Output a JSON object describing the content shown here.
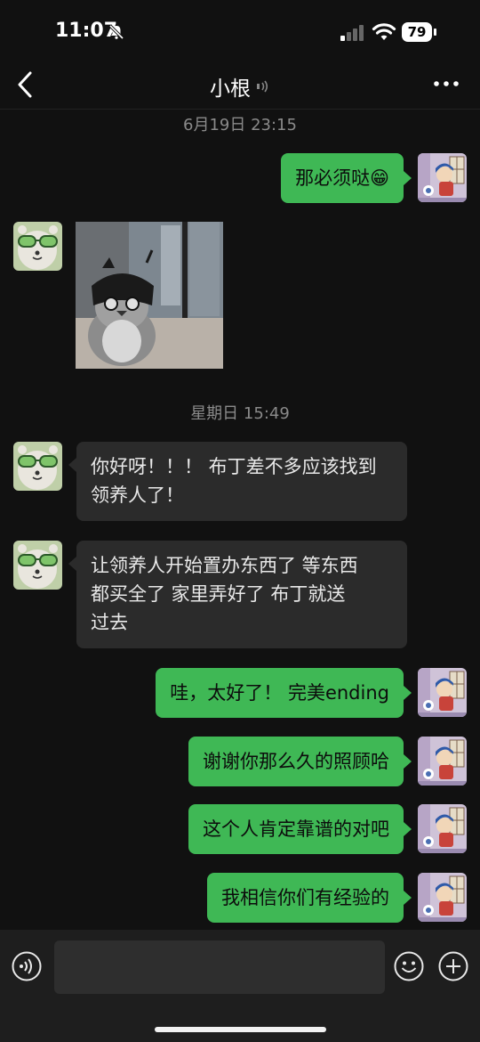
{
  "status_bar": {
    "time": "11:07",
    "battery": "79"
  },
  "nav": {
    "title": "小根"
  },
  "timestamps": [
    "6月19日 23:15",
    "星期日 15:49"
  ],
  "messages": [
    {
      "sender": "me",
      "text": "那必须哒😁"
    },
    {
      "sender": "other",
      "type": "image",
      "image_desc": "penguin-plush-with-black-bag-hat"
    },
    {
      "sender": "other",
      "text": "你好呀！！！ 布丁差不多应该找到领养人了！",
      "lines": [
        "你好呀！！！ 布丁差不多应该找到",
        "领养人了！"
      ]
    },
    {
      "sender": "other",
      "text": "让领养人开始置办东西了 等东西都买全了 家里弄好了 布丁就送过去",
      "lines": [
        "让领养人开始置办东西了 等东西",
        "都买全了 家里弄好了 布丁就送",
        "过去"
      ]
    },
    {
      "sender": "me",
      "text": "哇，太好了！ 完美ending"
    },
    {
      "sender": "me",
      "text": "谢谢你那么久的照顾哈"
    },
    {
      "sender": "me",
      "text": "这个人肯定靠谱的对吧"
    },
    {
      "sender": "me",
      "text": "我相信你们有经验的"
    }
  ],
  "icons": {
    "back": "chevron-left-icon",
    "sound": "sound-wave-icon",
    "more": "more-dots-icon",
    "voice": "voice-input-icon",
    "emoji": "emoji-icon",
    "plus": "plus-icon"
  },
  "colors": {
    "background": "#111111",
    "my_bubble": "#3fb855",
    "other_bubble": "#2b2b2b",
    "input_bar": "#1e1e1e"
  }
}
